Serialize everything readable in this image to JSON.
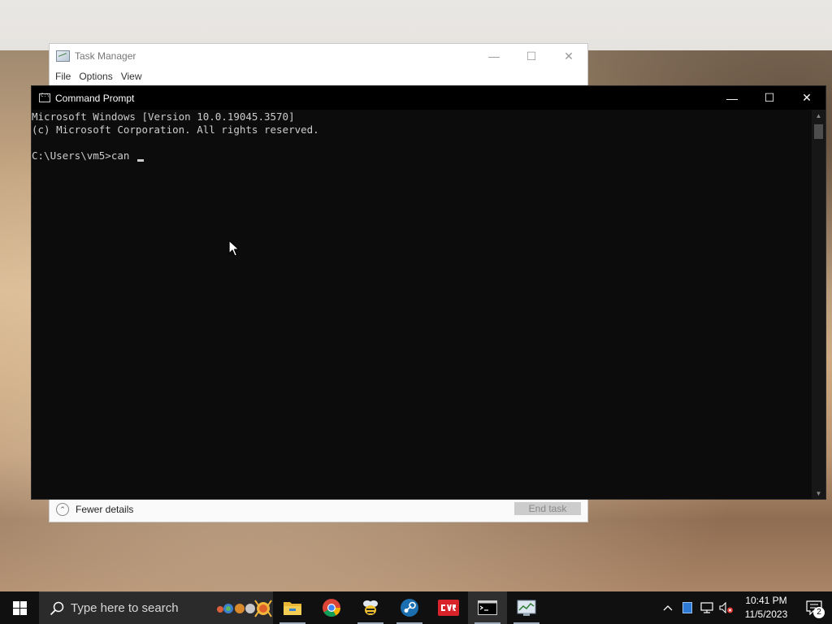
{
  "task_manager": {
    "title": "Task Manager",
    "menu": [
      "File",
      "Options",
      "View"
    ],
    "fewer_details": "Fewer details",
    "end_task": "End task"
  },
  "cmd": {
    "title": "Command Prompt",
    "lines": [
      "Microsoft Windows [Version 10.0.19045.3570]",
      "(c) Microsoft Corporation. All rights reserved.",
      "",
      "C:\\Users\\vm5>can "
    ]
  },
  "taskbar": {
    "search_placeholder": "Type here to search",
    "apps": [
      "file-explorer-icon",
      "chrome-icon",
      "bee-app-icon",
      "steam-icon",
      "red-app-icon",
      "command-prompt-icon",
      "task-manager-icon"
    ],
    "clock_time": "10:41 PM",
    "clock_date": "11/5/2023",
    "notification_count": "2"
  },
  "colors": {
    "console_bg": "#0c0c0c",
    "console_text": "#cccccc",
    "taskbar_bg": "#101010"
  }
}
